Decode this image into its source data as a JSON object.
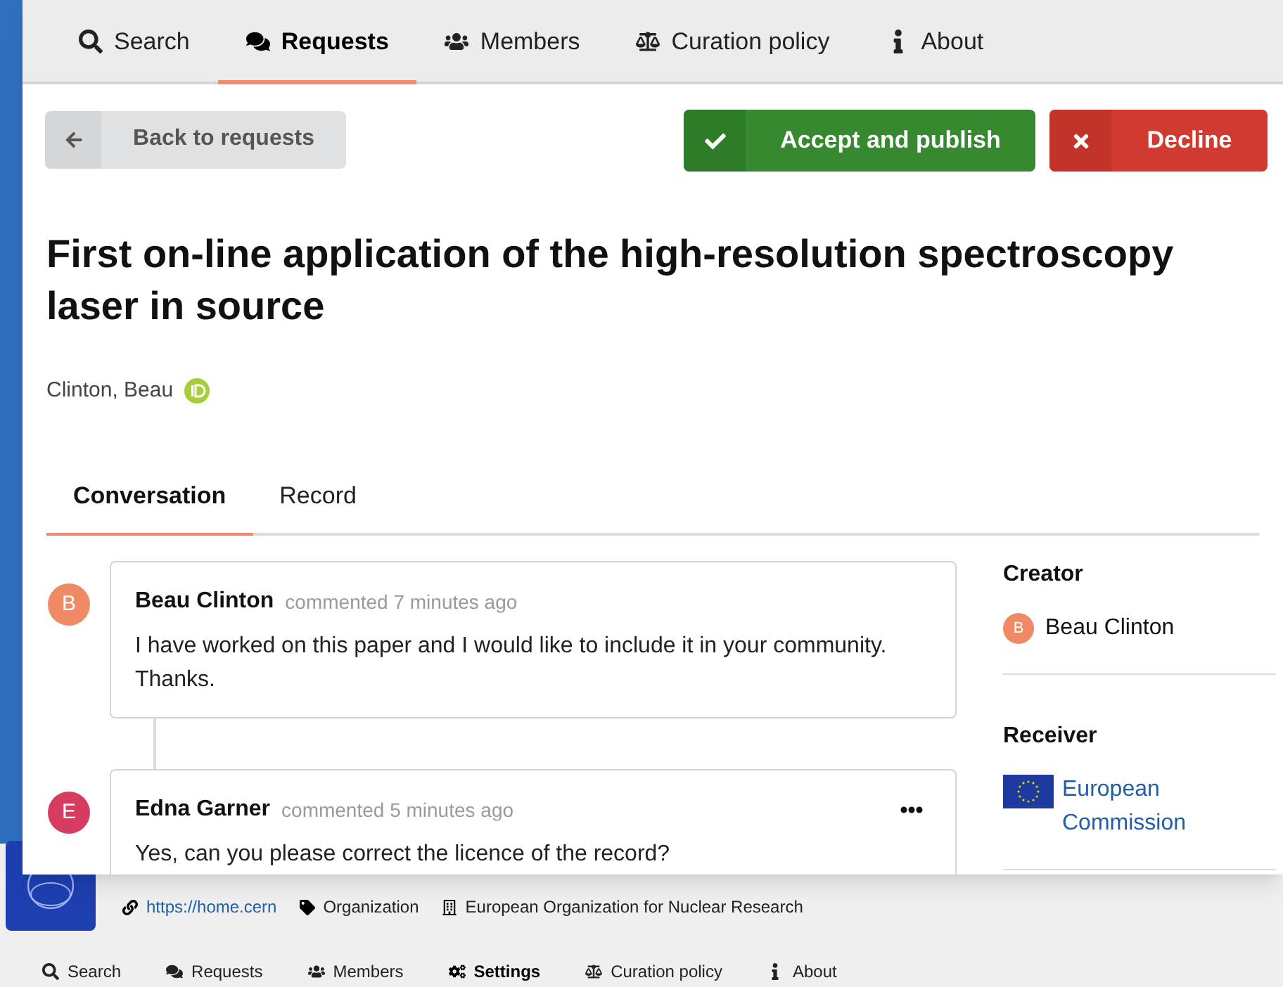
{
  "background_page": {
    "links": [
      {
        "kind": "url",
        "text": "https://home.cern"
      },
      {
        "kind": "tag",
        "text": "Organization"
      },
      {
        "kind": "building",
        "text": "European Organization for Nuclear Research"
      }
    ],
    "nav": [
      {
        "kind": "search",
        "label": "Search",
        "selected": false
      },
      {
        "kind": "requests",
        "label": "Requests",
        "selected": false
      },
      {
        "kind": "members",
        "label": "Members",
        "selected": false
      },
      {
        "kind": "settings",
        "label": "Settings",
        "selected": true
      },
      {
        "kind": "policy",
        "label": "Curation policy",
        "selected": false
      },
      {
        "kind": "about",
        "label": "About",
        "selected": false
      }
    ]
  },
  "dialog": {
    "nav": [
      {
        "kind": "search",
        "label": "Search",
        "selected": false
      },
      {
        "kind": "requests",
        "label": "Requests",
        "selected": true
      },
      {
        "kind": "members",
        "label": "Members",
        "selected": false
      },
      {
        "kind": "policy",
        "label": "Curation policy",
        "selected": false
      },
      {
        "kind": "about",
        "label": "About",
        "selected": false
      }
    ],
    "back_button": "Back to requests",
    "actions": [
      {
        "kind": "accept",
        "label": "Accept and publish"
      },
      {
        "kind": "decline",
        "label": "Decline"
      }
    ],
    "title": "First on-line application of the high-resolution spectroscopy laser in source",
    "author": "Clinton, Beau",
    "tabs": [
      {
        "label": "Conversation",
        "selected": true
      },
      {
        "label": "Record",
        "selected": false
      }
    ],
    "comments": [
      {
        "avatar": "B",
        "color": "#ee8a66",
        "author": "Beau Clinton",
        "meta": "commented 7 minutes ago",
        "text": "I have worked on this paper and I would like to include it in your community. Thanks.",
        "menu": false
      },
      {
        "avatar": "E",
        "color": "#d63c60",
        "author": "Edna Garner",
        "meta": "commented 5 minutes ago",
        "text": "Yes, can you please correct the licence of the record?",
        "menu": true
      }
    ],
    "sidebar": {
      "creator_heading": "Creator",
      "creator": {
        "avatar": "B",
        "color": "#ee8a66",
        "name": "Beau Clinton"
      },
      "receiver_heading": "Receiver",
      "receiver": "European Commission"
    }
  }
}
